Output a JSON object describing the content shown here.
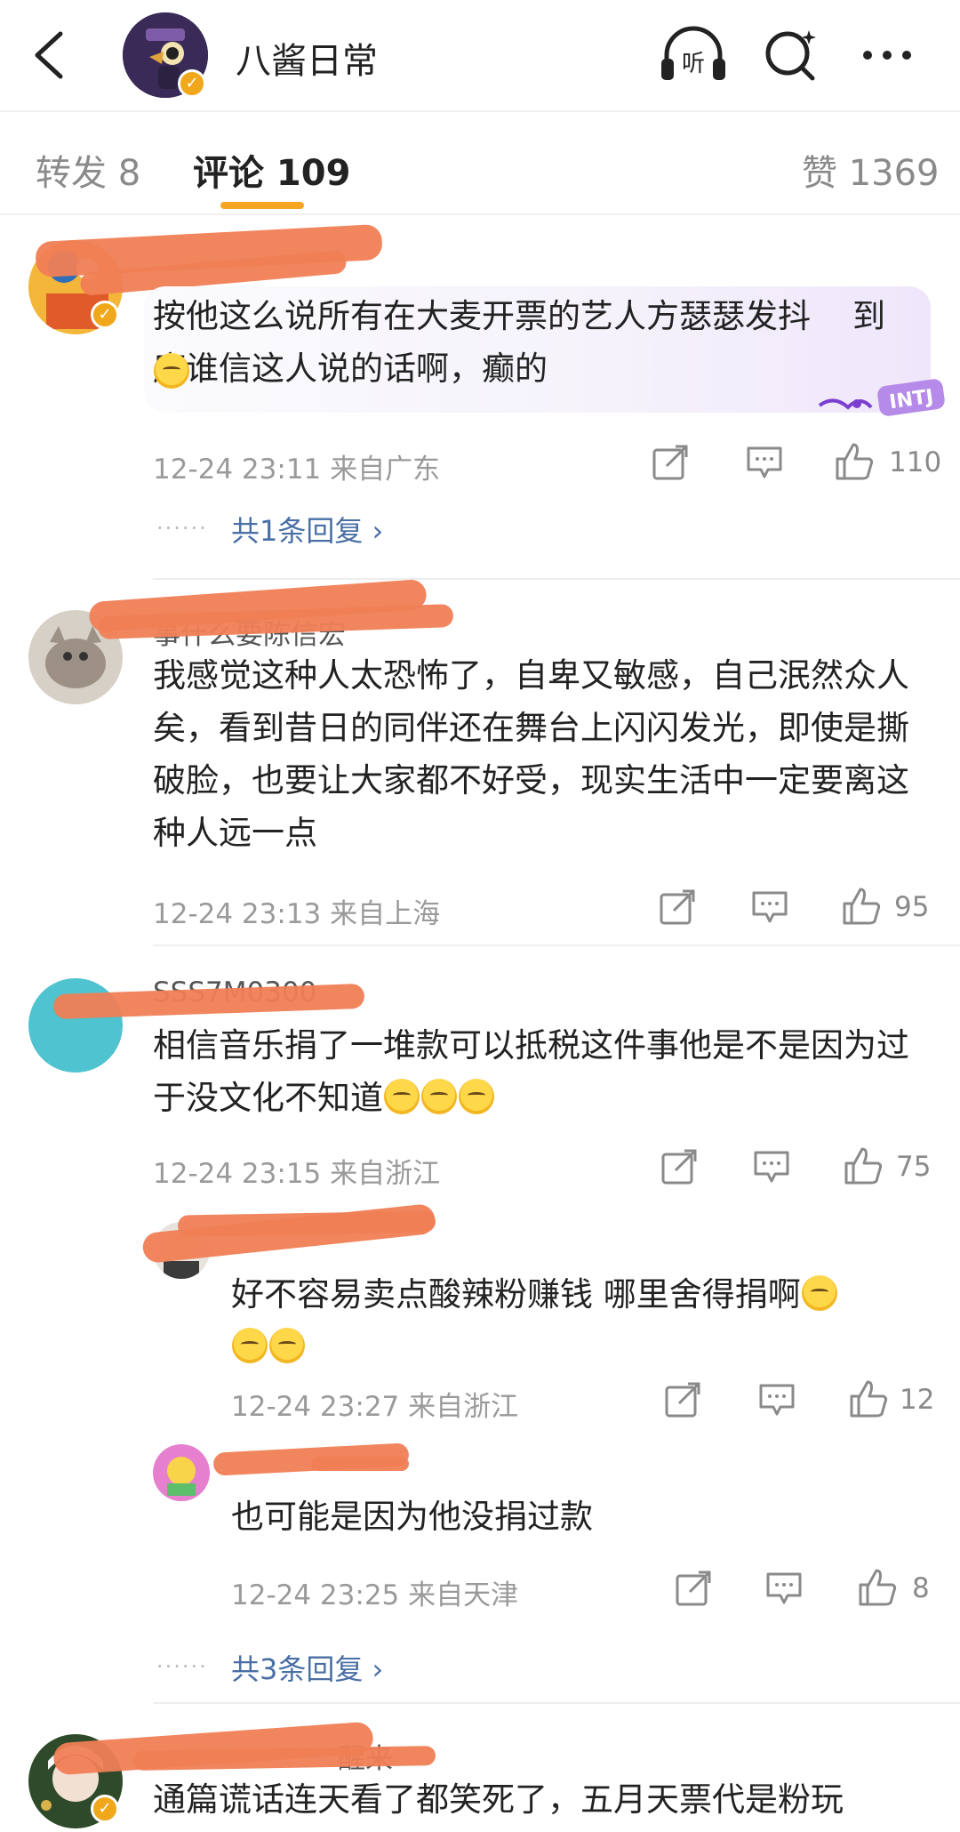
{
  "header": {
    "title": "八酱日常",
    "listen_label": "听"
  },
  "tabs": [
    {
      "label": "转发 8"
    },
    {
      "label": "评论 109"
    },
    {
      "label": "赞 1369"
    }
  ],
  "comments": [
    {
      "text": "按他这么说所有在大麦开票的艺人方瑟瑟发抖    到底谁信这人说的话啊，癫的",
      "time": "12-24 23:11",
      "location": "来自广东",
      "likes": "110",
      "more_replies": "共1条回复",
      "badge": "INTJ"
    },
    {
      "name": "事什么要陈信宏",
      "text": "我感觉这种人太恐怖了，自卑又敏感，自己泯然众人矣，看到昔日的同伴还在舞台上闪闪发光，即使是撕破脸，也要让大家都不好受，现实生活中一定要离这种人远一点",
      "time": "12-24 23:13",
      "location": "来自上海",
      "likes": "95"
    },
    {
      "name": "SSS7M0300",
      "text": "相信音乐捐了一堆款可以抵税这件事他是不是因为过于没文化不知道",
      "time": "12-24 23:15",
      "location": "来自浙江",
      "likes": "75",
      "replies": [
        {
          "text": "好不容易卖点酸辣粉赚钱 哪里舍得捐啊",
          "time": "12-24 23:27",
          "location": "来自浙江",
          "likes": "12"
        },
        {
          "text": "也可能是因为他没捐过款",
          "time": "12-24 23:25",
          "location": "来自天津",
          "likes": "8"
        }
      ],
      "more_replies": "共3条回复"
    },
    {
      "name": "醒来",
      "text": "通篇谎话连天看了都笑死了，五月天票代是粉玩"
    }
  ]
}
